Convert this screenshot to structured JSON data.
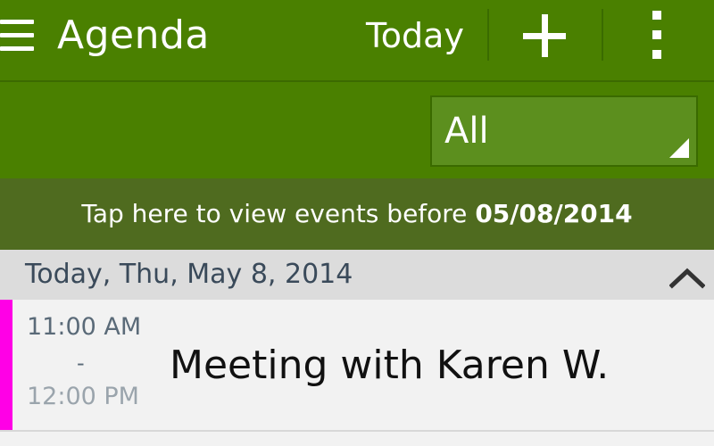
{
  "header": {
    "title": "Agenda",
    "today_label": "Today",
    "icons": [
      "menu-icon",
      "add-icon",
      "more-vert-icon"
    ]
  },
  "filter": {
    "selected": "All"
  },
  "banner": {
    "text": "Tap here to view events before ",
    "date": "05/08/2014"
  },
  "day": {
    "label": "Today, Thu, May 8, 2014"
  },
  "events": [
    {
      "start": "11:00 AM",
      "separator": "-",
      "end": "12:00 PM",
      "title": "Meeting with Karen W.",
      "color": "#ff00e6"
    }
  ],
  "colors": {
    "header_bg": "#4a8000",
    "banner_bg": "#4f6b1f",
    "event_accent": "#ff00e6"
  }
}
